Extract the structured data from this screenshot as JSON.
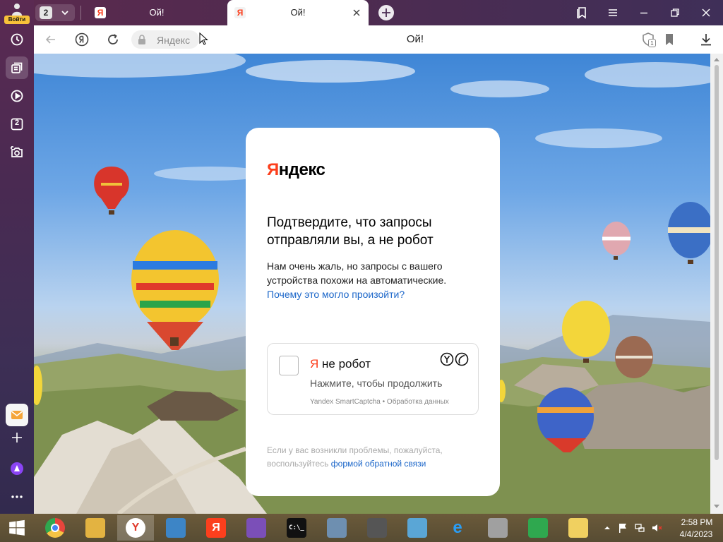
{
  "sidebar": {
    "login_label": "Войти",
    "items": [
      {
        "icon": "history-icon"
      },
      {
        "icon": "collections-icon"
      },
      {
        "icon": "video-play-icon"
      },
      {
        "icon": "tab-groups-icon",
        "label": "2"
      },
      {
        "icon": "screenshot-camera-icon"
      },
      {
        "icon": "mail-icon"
      },
      {
        "icon": "add-icon"
      },
      {
        "icon": "alice-assistant-icon"
      },
      {
        "icon": "more-icon"
      }
    ]
  },
  "tabbar": {
    "tab_count": "2",
    "tabs": [
      {
        "title": "Ой!",
        "favicon": "Я",
        "active": false
      },
      {
        "title": "Ой!",
        "favicon": "Я",
        "active": true
      }
    ]
  },
  "addressbar": {
    "site_name": "Яндекс",
    "page_title": "Ой!",
    "protect_badge": "1"
  },
  "card": {
    "logo_first": "Я",
    "logo_rest": "ндекс",
    "title": "Подтвердите, что запросы отправляли вы, а не робот",
    "body": "Нам очень жаль, но запросы с вашего устройства похожи на автоматические.",
    "body_link": "Почему это могло произойти?",
    "captcha": {
      "label_first": "Я",
      "label_rest": " не робот",
      "hint": "Нажмите, чтобы продолжить",
      "footer": "Yandex SmartCaptcha • Обработка данных"
    },
    "feedback_text": "Если у вас возникли проблемы, пожалуйста, воспользуйтесь",
    "feedback_link": "формой обратной связи"
  },
  "taskbar": {
    "apps": [
      {
        "name": "chrome",
        "color": "#e8453c"
      },
      {
        "name": "file-explorer",
        "color": "#e3b341"
      },
      {
        "name": "yandex-browser",
        "color": "#ffffff",
        "glyph": "Y"
      },
      {
        "name": "control-panel",
        "color": "#3d85c6"
      },
      {
        "name": "yandex",
        "color": "#fc3f1d",
        "glyph": "Я"
      },
      {
        "name": "visual-studio",
        "color": "#7b4fb8"
      },
      {
        "name": "command-prompt",
        "color": "#111111",
        "glyph": "C:\\_"
      },
      {
        "name": "resource-monitor",
        "color": "#6e8fb0"
      },
      {
        "name": "task-view",
        "color": "#555555"
      },
      {
        "name": "notebook",
        "color": "#5aa6d6"
      },
      {
        "name": "internet-explorer",
        "color": "#1e90ff",
        "glyph": "e"
      },
      {
        "name": "network-tool",
        "color": "#a0a0a0"
      },
      {
        "name": "store",
        "color": "#2fa84f"
      },
      {
        "name": "notepad",
        "color": "#f0d060"
      }
    ],
    "clock_time": "2:58 PM",
    "clock_date": "4/4/2023"
  }
}
